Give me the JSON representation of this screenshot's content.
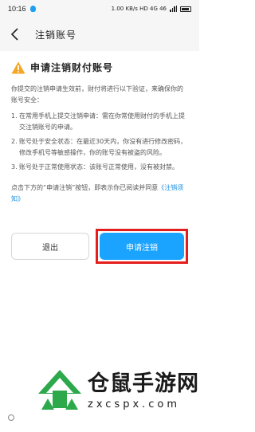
{
  "status_bar": {
    "time": "10:16",
    "right_text": "1.00 KB/s  HD  4G  46"
  },
  "header": {
    "title": "注销账号"
  },
  "warning": {
    "title": "申请注销财付账号"
  },
  "intro": "你提交的注销申请生效前，财付将进行以下验证，来确保你的账号安全：",
  "conditions": [
    {
      "num": "1.",
      "text": "在常用手机上提交注销申请：需在你常使用财付的手机上提交注销账号的申请。"
    },
    {
      "num": "2.",
      "text": "账号处于安全状态：在最近30天内，你没有进行修改密码，修改手机号等敏感操作，你的账号没有被盗的风险。"
    },
    {
      "num": "3.",
      "text": "账号处于正常使用状态：该账号正常使用，没有被封禁。"
    }
  ],
  "notice": {
    "prefix": "点击下方的“申请注销”按钮，即表示你已阅读并同意",
    "link": "《注销须知》"
  },
  "buttons": {
    "quit": "退出",
    "apply": "申请注销"
  },
  "watermark": {
    "name": "仓鼠手游网",
    "url": "zxcspx.com"
  },
  "colors": {
    "accent": "#1aa3ff",
    "highlight_border": "#e41d1d",
    "link": "#1e90e0",
    "warning": "#f5a623",
    "watermark_green": "#2da84a"
  }
}
